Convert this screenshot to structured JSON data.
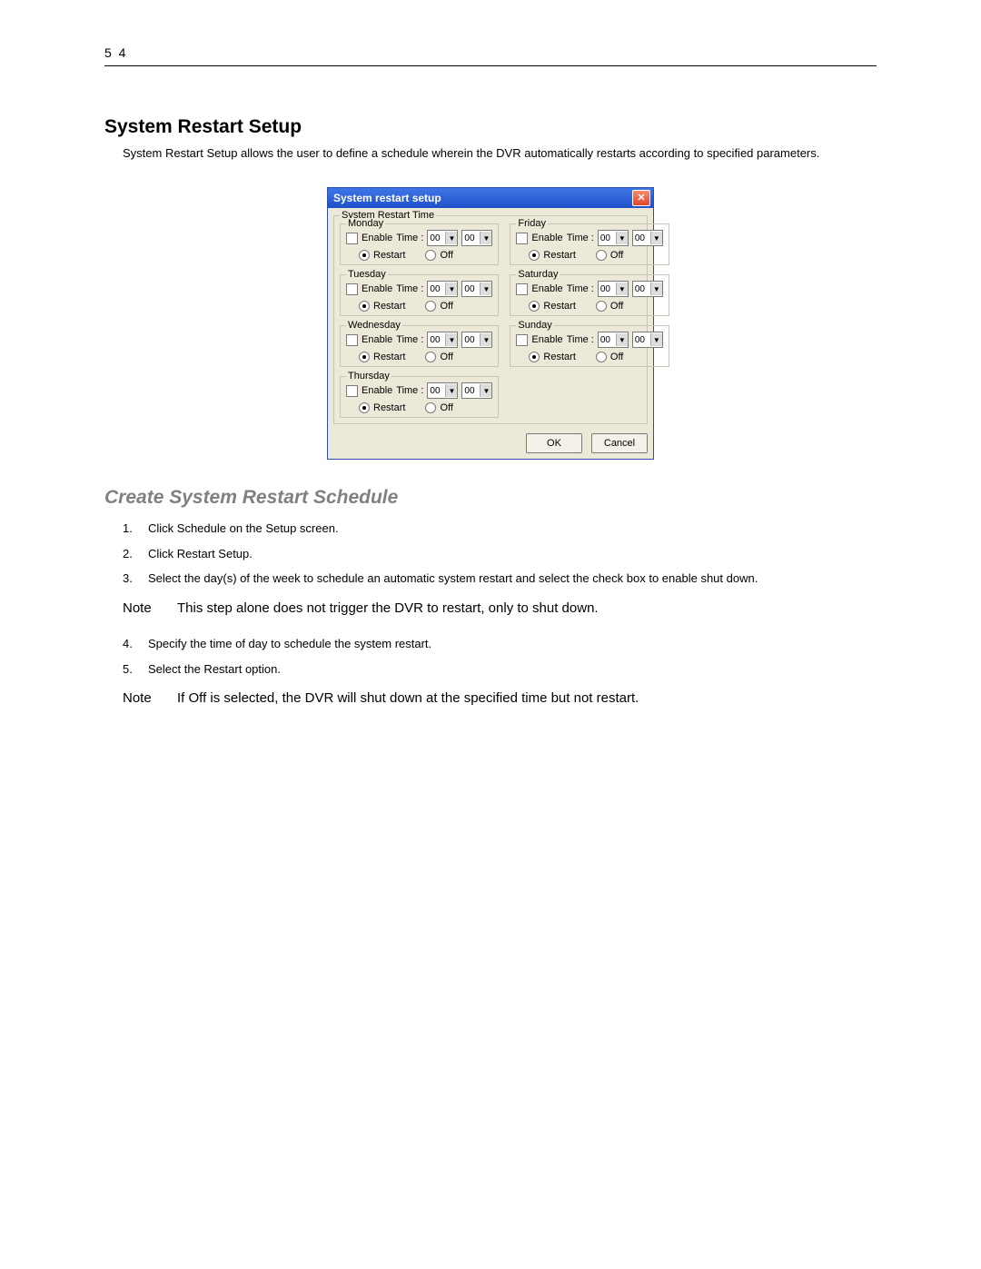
{
  "page_number": "5 4",
  "heading1": "System Restart Setup",
  "intro": "System Restart Setup allows the user to define a schedule wherein the DVR automatically restarts according to specified parameters.",
  "dialog": {
    "title": "System restart setup",
    "group_label": "System Restart Time",
    "enable_label": "Enable",
    "time_label": "Time :",
    "hour_value": "00",
    "minute_value": "00",
    "restart_label": "Restart",
    "off_label": "Off",
    "ok_label": "OK",
    "cancel_label": "Cancel",
    "days": {
      "mon": "Monday",
      "tue": "Tuesday",
      "wed": "Wednesday",
      "thu": "Thursday",
      "fri": "Friday",
      "sat": "Saturday",
      "sun": "Sunday"
    }
  },
  "heading2": "Create System Restart Schedule",
  "steps": {
    "s1": "Click Schedule on the Setup screen.",
    "s2": "Click Restart Setup.",
    "s3": "Select the day(s) of the week to schedule an automatic system restart and select the check box to enable shut down.",
    "s4": "Specify the time of day to schedule the system restart.",
    "s5": "Select the Restart option."
  },
  "note_label": "Note",
  "note1": "This step alone does not trigger the DVR to restart, only to shut down.",
  "note2": "If Off is selected, the DVR will shut down at the specified time but not restart."
}
